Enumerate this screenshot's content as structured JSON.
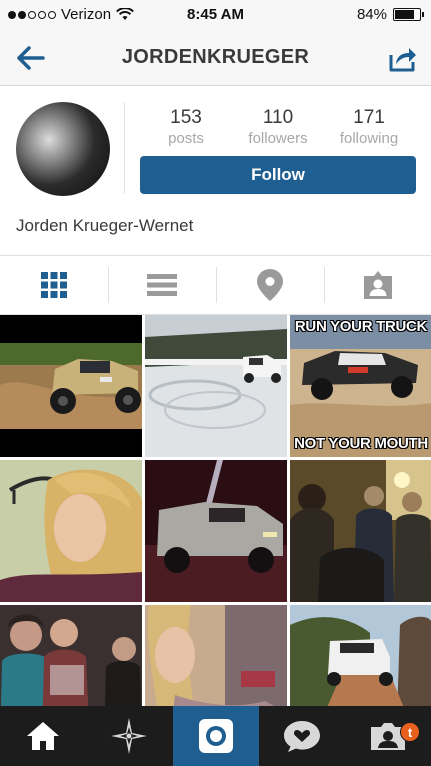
{
  "status_bar": {
    "carrier": "Verizon",
    "time": "8:45 AM",
    "battery": "84%",
    "battery_level": 0.84,
    "signal_bars": 2
  },
  "header": {
    "title": "JORDENKRUEGER",
    "back_icon": "arrow-left-icon",
    "share_icon": "share-icon"
  },
  "profile": {
    "posts_count": "153",
    "posts_label": "posts",
    "followers_count": "110",
    "followers_label": "followers",
    "following_count": "171",
    "following_label": "following",
    "follow_label": "Follow",
    "full_name": "Jorden Krueger-Wernet"
  },
  "view_tabs": [
    {
      "icon": "grid-icon",
      "active": true
    },
    {
      "icon": "list-icon",
      "active": false
    },
    {
      "icon": "location-pin-icon",
      "active": false
    },
    {
      "icon": "tagged-person-icon",
      "active": false
    }
  ],
  "photos": [
    {
      "name": "photo-truck-dirt"
    },
    {
      "name": "photo-truck-snow"
    },
    {
      "name": "photo-meme",
      "top_text": "RUN YOUR TRUCK",
      "bottom_text": "NOT YOUR MOUTH"
    },
    {
      "name": "photo-blonde-woman"
    },
    {
      "name": "photo-truck-night"
    },
    {
      "name": "photo-party-room"
    },
    {
      "name": "photo-friends"
    },
    {
      "name": "photo-selfie"
    },
    {
      "name": "photo-truck-trail"
    }
  ],
  "bottom_nav": [
    {
      "icon": "home-icon",
      "active": false
    },
    {
      "icon": "explore-icon",
      "active": false
    },
    {
      "icon": "camera-icon",
      "active": true
    },
    {
      "icon": "activity-icon",
      "active": false
    },
    {
      "icon": "profile-icon",
      "active": false,
      "badge": "t"
    }
  ],
  "colors": {
    "accent": "#1f5e91",
    "tab_active": "#1f5e91",
    "tab_inactive": "#9a9a9a",
    "nav_background": "#1c1c1c",
    "badge": "#e8611d"
  }
}
